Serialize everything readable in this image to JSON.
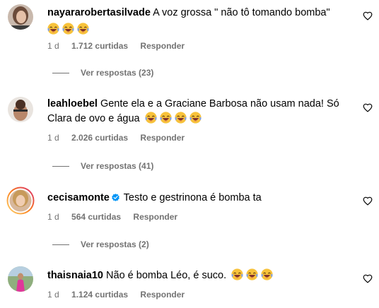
{
  "comments": [
    {
      "username": "nayararobertasilvade",
      "text": "A voz grossa \" não tô tomando bomba\"",
      "emoji_count": 3,
      "time": "1 d",
      "likes": "1.712 curtidas",
      "reply_label": "Responder",
      "view_replies": "Ver respostas (23)",
      "verified": false
    },
    {
      "username": "leahloebel",
      "text": "Gente ela e a Graciane Barbosa não usam nada! Só Clara de ovo e água",
      "emoji_count": 4,
      "time": "1 d",
      "likes": "2.026 curtidas",
      "reply_label": "Responder",
      "view_replies": "Ver respostas (41)",
      "verified": false
    },
    {
      "username": "cecisamonte",
      "text": "Testo e gestrinona é bomba ta",
      "emoji_count": 0,
      "time": "1 d",
      "likes": "564 curtidas",
      "reply_label": "Responder",
      "view_replies": "Ver respostas (2)",
      "verified": true
    },
    {
      "username": "thaisnaia10",
      "text": "Não é bomba Léo, é suco.",
      "emoji_count": 3,
      "time": "1 d",
      "likes": "1.124 curtidas",
      "reply_label": "Responder",
      "verified": false
    }
  ],
  "icons": {
    "like": "heart-outline-icon",
    "emoji": "laughing-crying-emoji",
    "verified": "verified-badge-icon"
  },
  "colors": {
    "meta_text": "#737373",
    "verified_blue": "#0095f6",
    "story_ring_start": "#feda75",
    "story_ring_end": "#d62976"
  }
}
